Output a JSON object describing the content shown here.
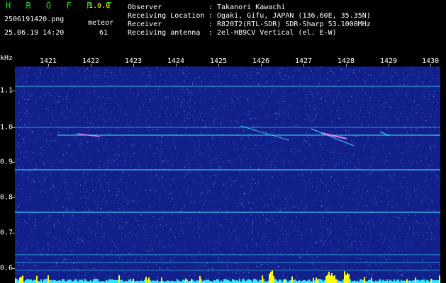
{
  "app": {
    "title": "H R O F F T",
    "version": "1.0.0"
  },
  "file": {
    "name": "2506191420.png",
    "datetime": "25.06.19 14:20"
  },
  "meteor": {
    "label": "meteor",
    "count": "61"
  },
  "info": [
    {
      "key": "Observer",
      "value": ": Takanori Kawachi"
    },
    {
      "key": "Receiving Location",
      "value": ": Ogaki, Gifu, JAPAN (136.60E, 35.35N)"
    },
    {
      "key": "Receiver",
      "value": ": R820T2(RTL-SDR) SDR-Sharp 53.1000MHz"
    },
    {
      "key": "Receiving antenna",
      "value": ": 2el-HB9CV Vertical (el. E-W)"
    }
  ],
  "axis": {
    "unit": "kHz",
    "time_labels": [
      "1421",
      "1422",
      "1423",
      "1424",
      "1425",
      "1426",
      "1427",
      "1428",
      "1429",
      "1430"
    ],
    "freq_labels": [
      "1.1",
      "1.0",
      "0.9",
      "0.8",
      "0.7",
      "0.6"
    ]
  },
  "colors": {
    "background": "#11208a",
    "noise": "#4a7cff",
    "carrier": "#38e6ff",
    "meteor": "#ff88ff",
    "activity": "#ffff00",
    "title": "#22dd22",
    "version": "#ffff33"
  }
}
